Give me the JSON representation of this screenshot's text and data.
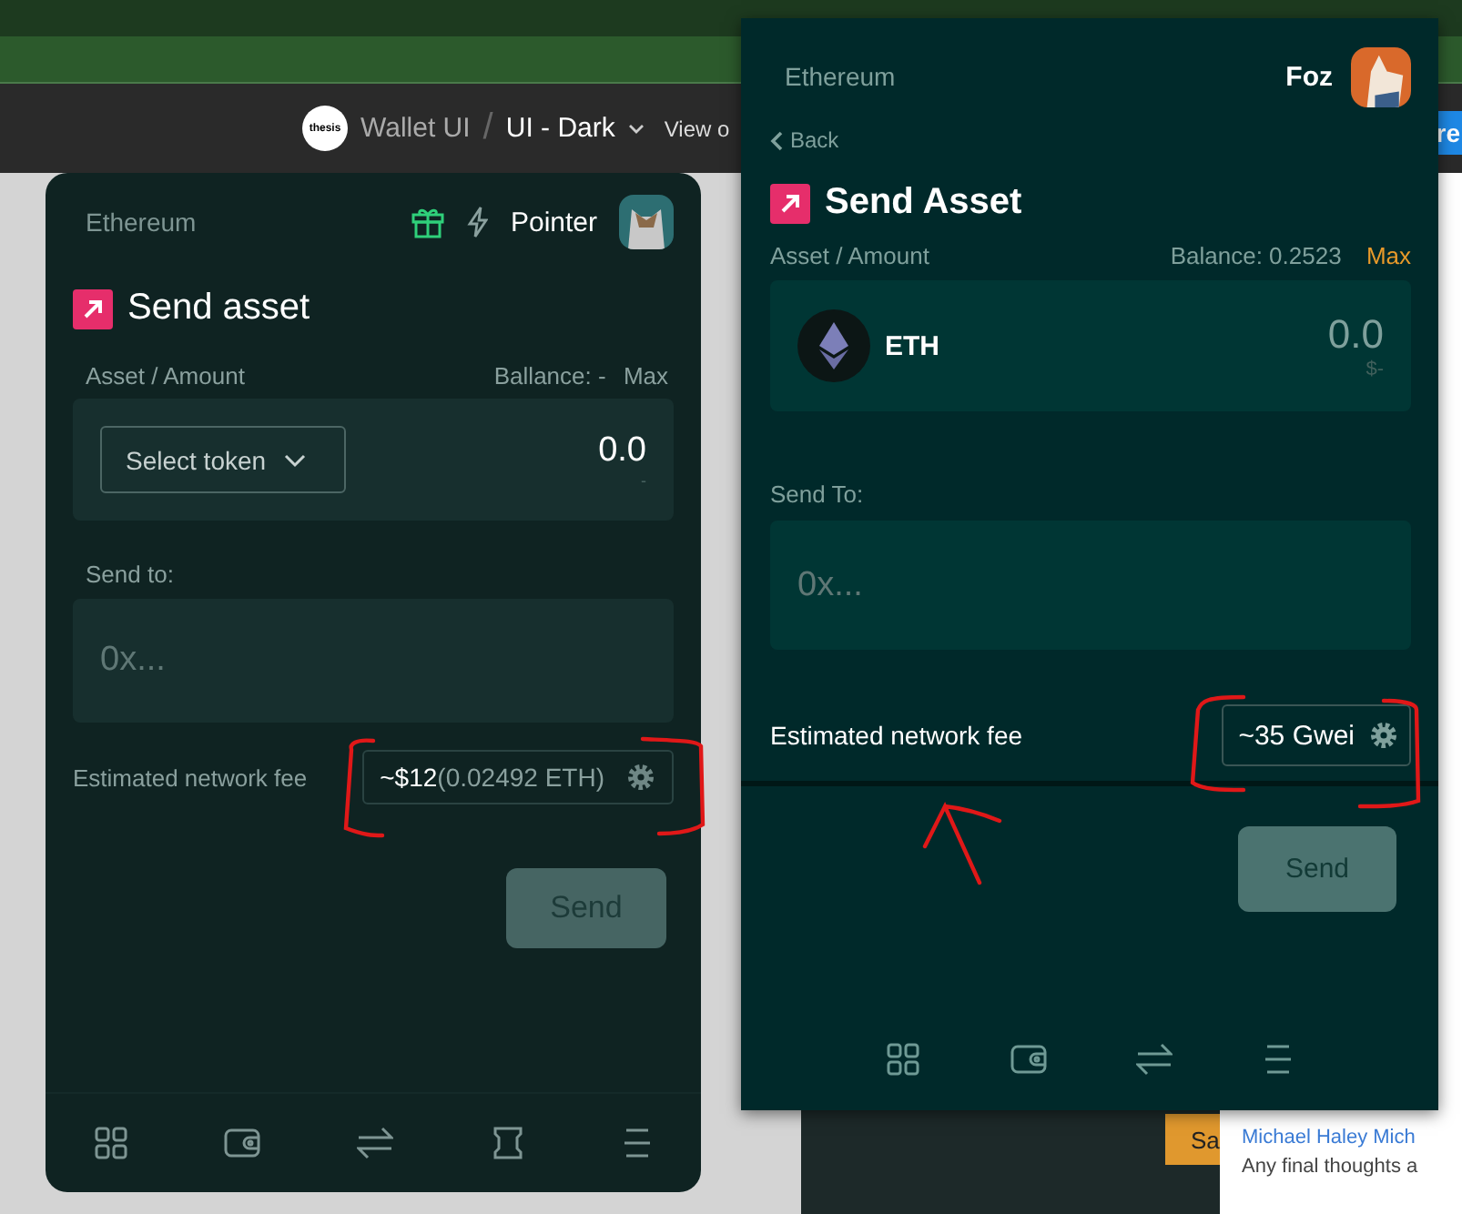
{
  "app_bar": {
    "logo": "thesis",
    "breadcrumb": [
      "Wallet UI",
      "UI - Dark"
    ],
    "separator": "/",
    "view": "View o",
    "share": "re"
  },
  "left_wallet": {
    "network": "Ethereum",
    "user": "Pointer",
    "title": "Send asset",
    "asset_label": "Asset / Amount",
    "balance": "Ballance: -",
    "max": "Max",
    "token_select": "Select token",
    "amount": "0.0",
    "amount_usd": "-",
    "send_to_label": "Send to:",
    "address_placeholder": "0x...",
    "fee_label": "Estimated network fee",
    "fee": "**~$12**(0.02492 ETH)",
    "send": {
      "label": "Send",
      "disabled": true
    },
    "nav": [
      {
        "kind": "grid"
      },
      {
        "kind": "wallet"
      },
      {
        "kind": "swap"
      },
      {
        "kind": "bone"
      },
      {
        "kind": "menu"
      }
    ]
  },
  "background_card": {
    "button": "Sa"
  },
  "side_panel": {
    "author": "Michael Haley Mich",
    "comment": "Any final thoughts a"
  },
  "popup_wallet": {
    "network": "Ethereum",
    "user": "Foz",
    "back": "Back",
    "title": "Send Asset",
    "asset_label": "Asset / Amount",
    "balance": "Balance: 0.2523",
    "max": "Max",
    "token": "ETH",
    "amount": "0.0",
    "amount_usd": "$-",
    "send_to_label": "Send To:",
    "address_placeholder": "0x...",
    "fee_label": "Estimated network fee",
    "fee": "~35 Gwei",
    "send": {
      "label": "Send",
      "disabled": true
    },
    "nav": [
      {
        "kind": "grid"
      },
      {
        "kind": "wallet"
      },
      {
        "kind": "swap"
      },
      {
        "kind": "menu"
      }
    ]
  }
}
